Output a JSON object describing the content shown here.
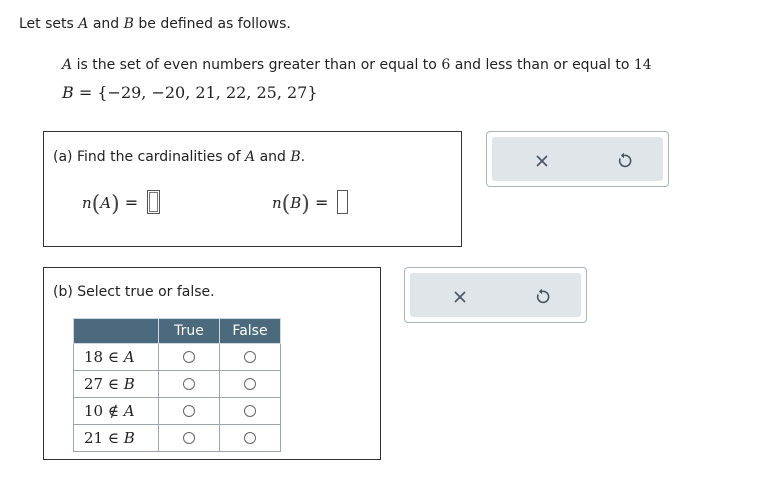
{
  "intro": {
    "pre": "Let sets ",
    "set_a": "A",
    "and": " and ",
    "set_b": "B",
    "post": " be defined as follows."
  },
  "definitions": {
    "a_name": "A",
    "a_text": " is the set of even numbers greater than or equal to ",
    "a_low": "6",
    "a_mid": " and less than or equal to ",
    "a_high": "14",
    "b_name": "B",
    "b_equals": " = ",
    "b_open": "{",
    "b_elements": "−29, −20, 21, 22, 25, 27",
    "b_close": "}"
  },
  "part_a": {
    "prefix": "(a) Find the cardinalities of ",
    "set_a": "A",
    "and": " and ",
    "set_b": "B",
    "period": ".",
    "n_symbol": "n",
    "eq": " = ",
    "left_set": "A",
    "right_set": "B",
    "n_a_value": "",
    "n_b_value": ""
  },
  "part_b": {
    "heading": "(b) Select true or false.",
    "col_true": "True",
    "col_false": "False",
    "rows": [
      {
        "num": "18",
        "op": " ∈ ",
        "set": "A"
      },
      {
        "num": "27",
        "op": " ∈ ",
        "set": "B"
      },
      {
        "num": "10",
        "op": " ∉ ",
        "set": "A"
      },
      {
        "num": "21",
        "op": " ∈ ",
        "set": "B"
      }
    ]
  },
  "icons": {
    "clear": "close-x-icon",
    "reset": "undo-arrow-icon"
  },
  "colors": {
    "table_header_bg": "#4b6a7d",
    "action_bg": "#dfe5e9"
  }
}
